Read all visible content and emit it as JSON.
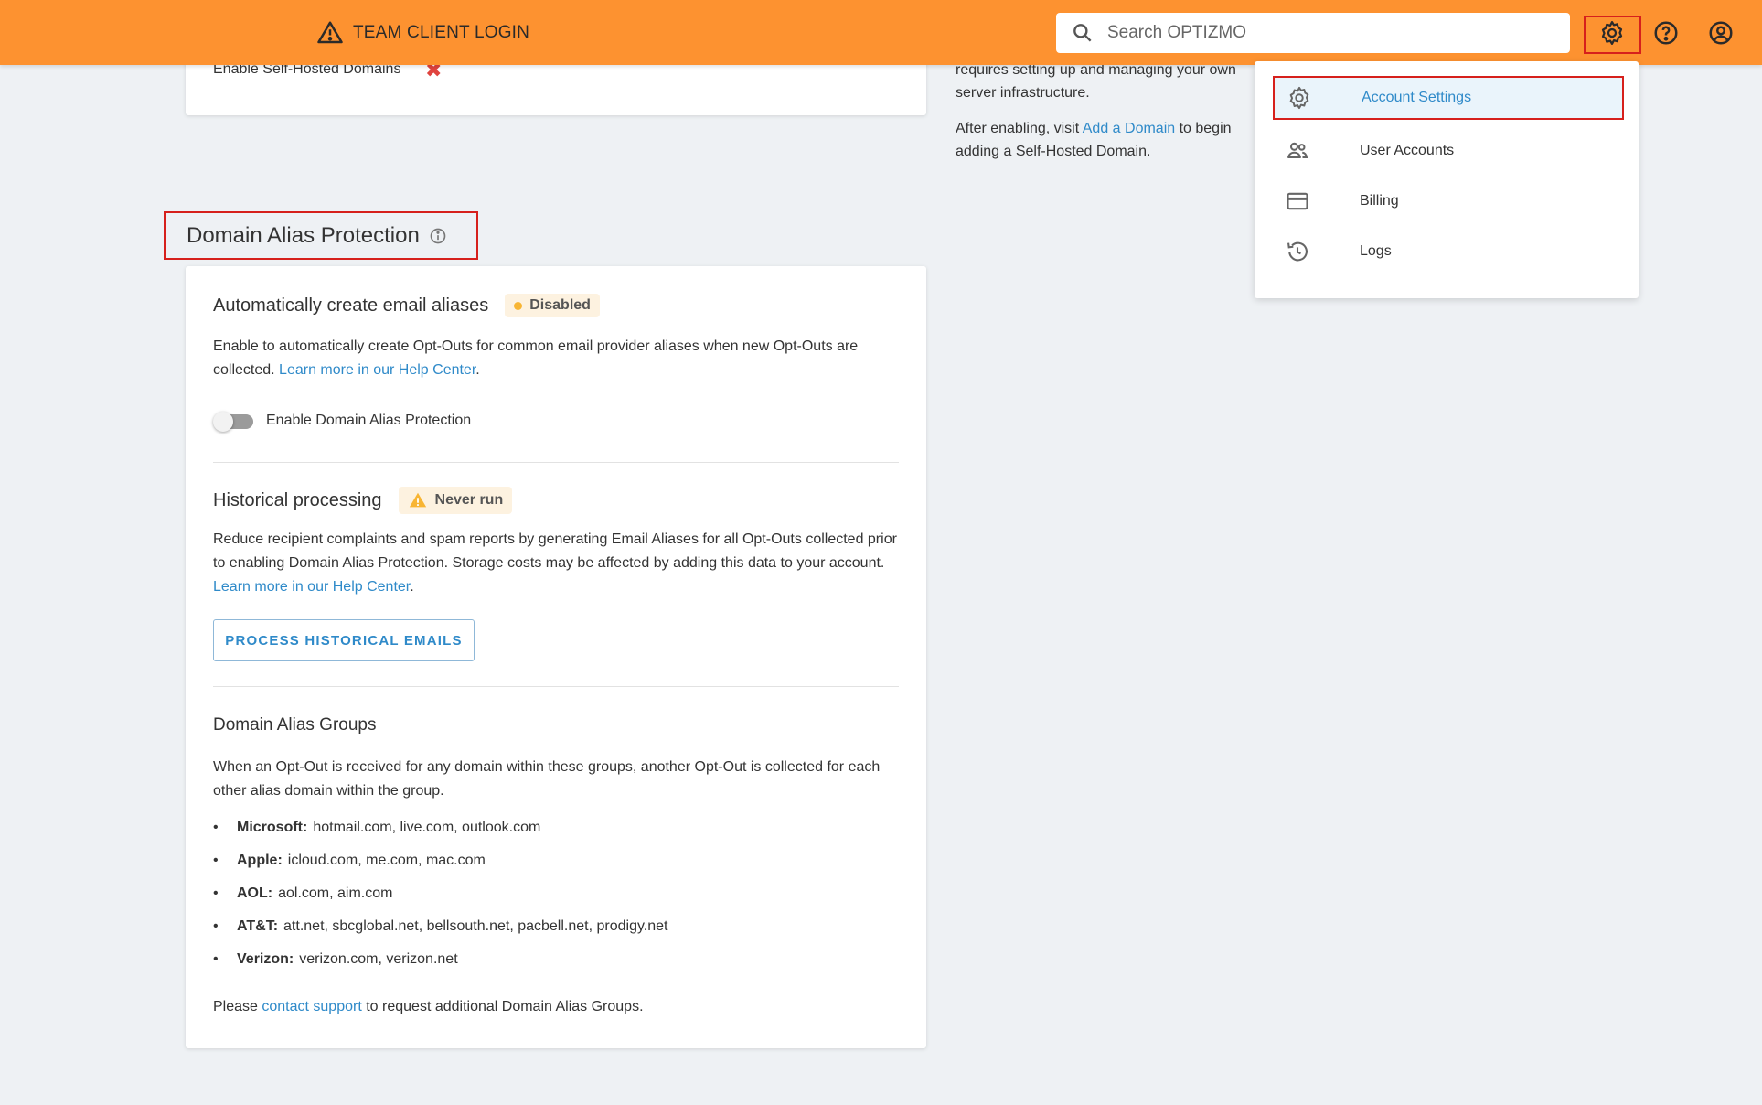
{
  "header": {
    "team_login": "TEAM CLIENT LOGIN",
    "search_placeholder": "Search OPTIZMO",
    "accent_color": "#fd9230"
  },
  "top_card": {
    "enable_self_hosted_label": "Enable Self-Hosted Domains",
    "status_icon": "x-mark-icon"
  },
  "side_text": {
    "line1": "requires setting up and managing your own server infrastructure.",
    "after_prefix": "After enabling, visit ",
    "add_domain_link": "Add a Domain",
    "after_suffix": " to begin adding a Self-Hosted Domain."
  },
  "section": {
    "title": "Domain Alias Protection"
  },
  "auto_alias": {
    "heading": "Automatically create email aliases",
    "badge": "Disabled",
    "description": "Enable to automatically create Opt-Outs for common email provider aliases when new Opt-Outs are collected. ",
    "help_link": "Learn more in our Help Center",
    "toggle_label": "Enable Domain Alias Protection"
  },
  "historical": {
    "heading": "Historical processing",
    "badge": "Never run",
    "description": "Reduce recipient complaints and spam reports by generating Email Aliases for all Opt-Outs collected prior to enabling Domain Alias Protection. Storage costs may be affected by adding this data to your account. ",
    "help_link": "Learn more in our Help Center",
    "button": "PROCESS HISTORICAL EMAILS"
  },
  "groups": {
    "heading": "Domain Alias Groups",
    "description": "When an Opt-Out is received for any domain within these groups, another Opt-Out is collected for each other alias domain within the group.",
    "items": [
      {
        "provider": "Microsoft:",
        "domains": "hotmail.com, live.com, outlook.com"
      },
      {
        "provider": "Apple:",
        "domains": "icloud.com, me.com, mac.com"
      },
      {
        "provider": "AOL:",
        "domains": "aol.com, aim.com"
      },
      {
        "provider": "AT&T:",
        "domains": "att.net, sbcglobal.net, bellsouth.net, pacbell.net, prodigy.net"
      },
      {
        "provider": "Verizon:",
        "domains": "verizon.com, verizon.net"
      }
    ],
    "footer_prefix": "Please ",
    "footer_link": "contact support",
    "footer_suffix": " to request additional Domain Alias Groups."
  },
  "settings_menu": {
    "items": [
      {
        "label": "Account Settings",
        "icon": "gear-icon"
      },
      {
        "label": "User Accounts",
        "icon": "users-icon"
      },
      {
        "label": "Billing",
        "icon": "credit-card-icon"
      },
      {
        "label": "Logs",
        "icon": "history-icon"
      }
    ]
  }
}
